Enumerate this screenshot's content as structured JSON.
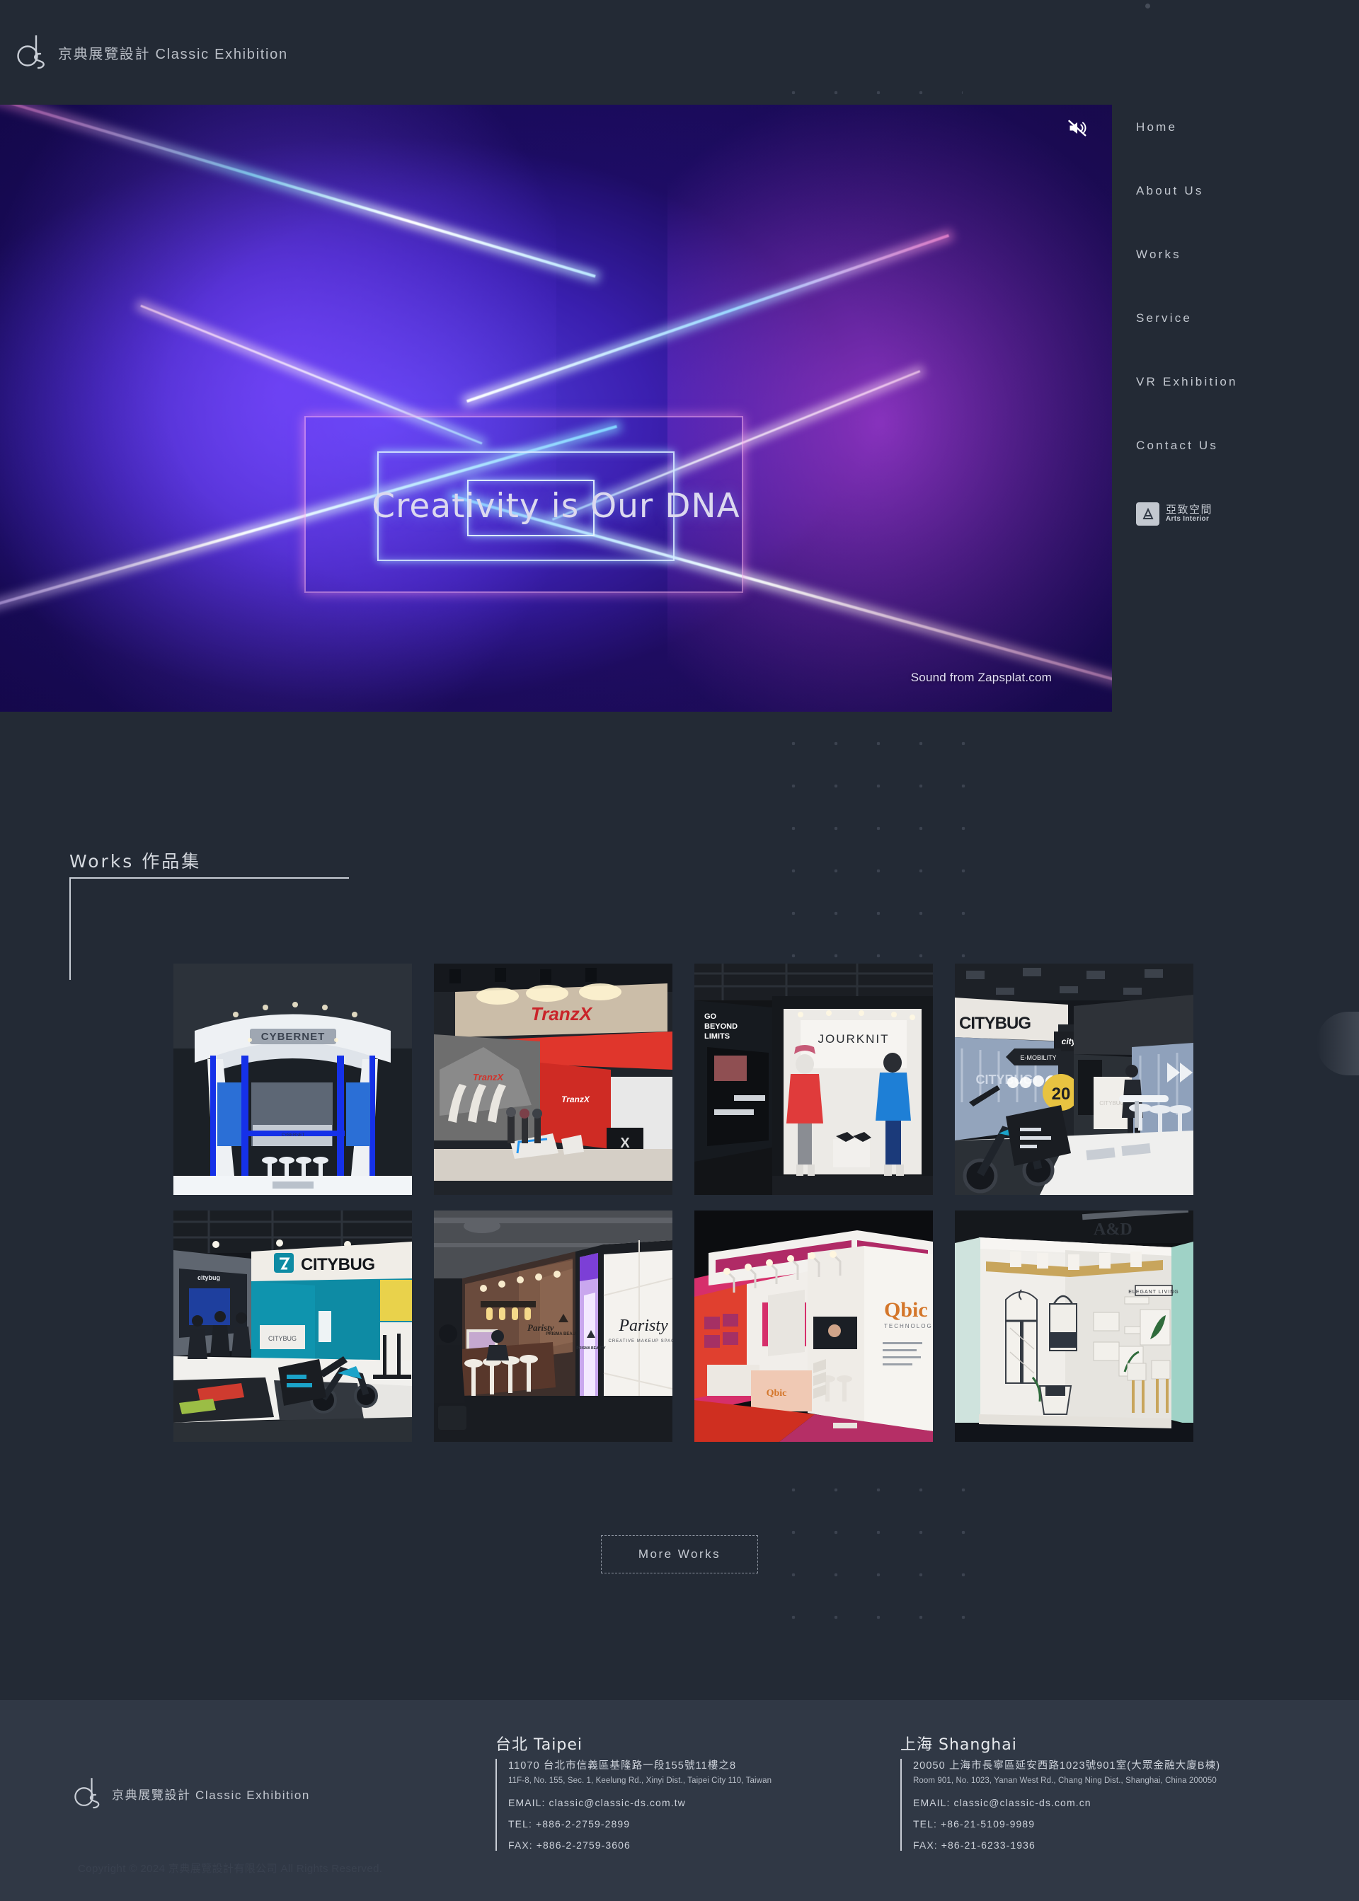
{
  "site": {
    "brand_cn": "京典展覽設計",
    "brand_en": "Classic Exhibition",
    "logo_icon": "ds-monogram-logo"
  },
  "nav": {
    "items": [
      {
        "label": "Home",
        "name": "nav-home"
      },
      {
        "label": "About Us",
        "name": "nav-about-us"
      },
      {
        "label": "Works",
        "name": "nav-works"
      },
      {
        "label": "Service",
        "name": "nav-service"
      },
      {
        "label": "VR Exhibition",
        "name": "nav-vr-exhibition"
      },
      {
        "label": "Contact Us",
        "name": "nav-contact-us"
      }
    ],
    "partner": {
      "name_cn": "亞致空間",
      "name_en": "Arts Interior",
      "icon": "arts-interior-logo"
    }
  },
  "hero": {
    "tagline": "Creativity is Our DNA",
    "sound_credit": "Sound from Zapsplat.com",
    "mute_icon": "speaker-muted-icon",
    "muted": true
  },
  "works": {
    "title": "Works 作品集",
    "more_button": "More Works",
    "items": [
      {
        "name": "work-cybernet",
        "caption": "CYBERNET",
        "accent": "#1a3fd6"
      },
      {
        "name": "work-tranzx",
        "caption": "TranzX",
        "accent": "#c9242a"
      },
      {
        "name": "work-gobeyond",
        "caption": "GO BEYOND LIMITS",
        "accent": "#d93a3a"
      },
      {
        "name": "work-citybug-20",
        "caption": "CITYBUG",
        "accent": "#e8c341"
      },
      {
        "name": "work-citybug-teal",
        "caption": "CITYBUG",
        "accent": "#0e8ba4"
      },
      {
        "name": "work-paristy",
        "caption": "PARISTY",
        "accent": "#b07aff"
      },
      {
        "name": "work-qbic",
        "caption": "Qbic TECHNOLOGY",
        "accent": "#d62f6b"
      },
      {
        "name": "work-ad-elegant",
        "caption": "A&D",
        "accent": "#8fd6c8"
      }
    ]
  },
  "footer": {
    "brand_cn": "京典展覽設計",
    "brand_en": "Classic Exhibition",
    "copyright": "Copyright © 2024 京典展覽設計有限公司 All Rights Reserved.",
    "offices": [
      {
        "name": "台北 Taipei",
        "address_cn": "11070 台北市信義區基隆路一段155號11樓之8",
        "address_en": "11F-8, No. 155, Sec. 1, Keelung Rd., Xinyi Dist., Taipei City 110, Taiwan",
        "email": "EMAIL: classic@classic-ds.com.tw",
        "tel": "TEL: +886-2-2759-2899",
        "fax": "FAX: +886-2-2759-3606"
      },
      {
        "name": "上海 Shanghai",
        "address_cn": "20050 上海市長寧區延安西路1023號901室(大眾金融大廈B棟)",
        "address_en": "Room 901, No. 1023, Yanan West Rd., Chang Ning Dist., Shanghai, China 200050",
        "email": "EMAIL: classic@classic-ds.com.cn",
        "tel": "TEL: +86-21-5109-9989",
        "fax": "FAX: +86-21-6233-1936"
      }
    ]
  },
  "theme": {
    "background": "#232a35",
    "footer_background": "#303845",
    "text": "#c3c8d0",
    "dot_color": "#3c4350"
  }
}
